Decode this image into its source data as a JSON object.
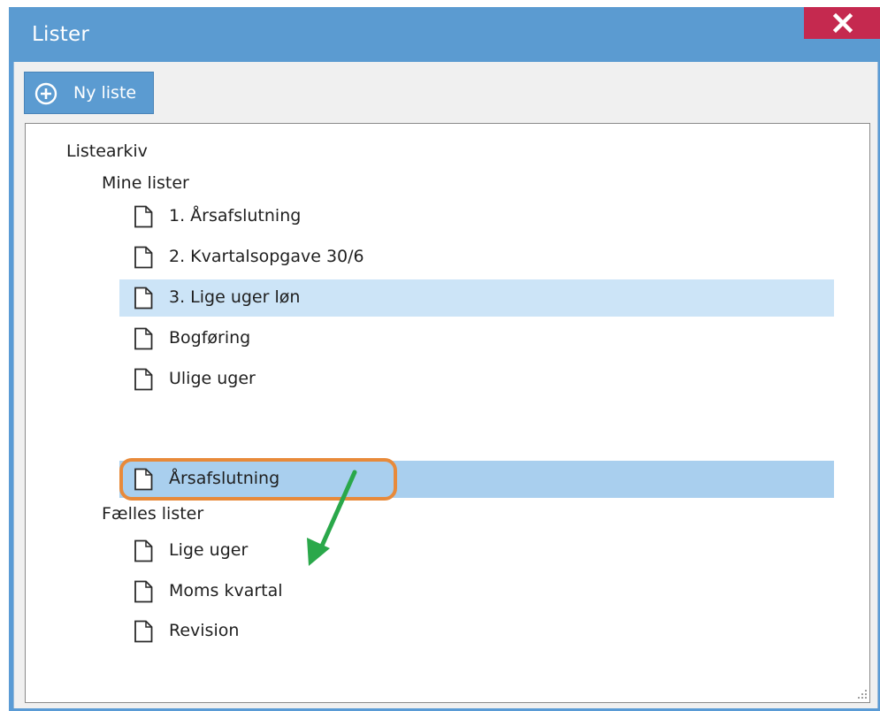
{
  "window": {
    "title": "Lister",
    "close_label": "Close"
  },
  "toolbar": {
    "new_list_label": "Ny liste",
    "new_list_icon": "plus-circle-icon"
  },
  "tree": {
    "root": {
      "label": "Listearkiv",
      "expanded": true
    },
    "groups": [
      {
        "label": "Mine lister",
        "expanded": true,
        "items": [
          {
            "label": "1. Årsafslutning",
            "icon": "document-icon",
            "state": "normal"
          },
          {
            "label": "2. Kvartalsopgave 30/6",
            "icon": "document-icon",
            "state": "normal"
          },
          {
            "label": "3. Lige uger løn",
            "icon": "document-icon",
            "state": "hover"
          },
          {
            "label": "Bogføring",
            "icon": "document-icon",
            "state": "normal"
          },
          {
            "label": "Ulige uger",
            "icon": "document-icon",
            "state": "normal"
          },
          {
            "label": "Årsafslutning",
            "icon": "document-icon",
            "state": "selected"
          }
        ]
      },
      {
        "label": "Fælles lister",
        "expanded": true,
        "items": [
          {
            "label": "Lige uger",
            "icon": "document-icon",
            "state": "normal"
          },
          {
            "label": "Moms kvartal",
            "icon": "document-icon",
            "state": "normal"
          },
          {
            "label": "Revision",
            "icon": "document-icon",
            "state": "normal"
          }
        ]
      }
    ]
  },
  "annotations": {
    "callout_color": "#e88a3a",
    "arrow_color": "#2aa84a"
  },
  "colors": {
    "titlebar": "#5b9bd1",
    "close": "#c5294f",
    "hover_row": "#cce4f7",
    "selected_row": "#a9cfee"
  }
}
